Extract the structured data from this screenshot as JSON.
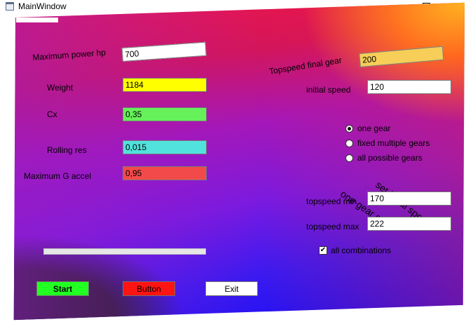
{
  "window": {
    "title": "MainWindow",
    "min_glyph": "—",
    "close_glyph": "✕"
  },
  "inputs": {
    "max_power": {
      "label": "Maximum power hp",
      "value": "700",
      "bg": "#ffffff"
    },
    "weight": {
      "label": "Weight",
      "value": "1184",
      "bg": "#ffff00"
    },
    "cx": {
      "label": "Cx",
      "value": "0,35",
      "bg": "#66f15a"
    },
    "rolling_res": {
      "label": "Rolling res",
      "value": "0,015",
      "bg": "#52e2dd"
    },
    "max_g_accel": {
      "label": "Maximum G accel",
      "value": "0,95",
      "bg": "#f24a4a"
    },
    "topspeed_final_gear": {
      "label": "Topspeed final gear",
      "value": "200",
      "bg": "#f6ce58"
    },
    "initial_speed": {
      "label": "initial speed",
      "value": "120",
      "bg": "#ffffff"
    },
    "topspeed_min": {
      "label": "topspeed min",
      "value": "170",
      "bg": "#ffffff"
    },
    "topspeed_max": {
      "label": "topspeed max",
      "value": "222",
      "bg": "#ffffff"
    }
  },
  "gear_mode": {
    "options": [
      "one gear",
      "fixed multiple gears",
      "all possible gears"
    ],
    "selected": "one gear"
  },
  "rotated_labels": {
    "set_initial_speed": "set initial speed",
    "one_gear_only": "one gear only"
  },
  "all_combinations": {
    "label": "all combinations",
    "checked": true,
    "check_glyph": "✔"
  },
  "progress": {
    "value": 0
  },
  "buttons": {
    "start": {
      "label": "Start",
      "bg": "#22ff22"
    },
    "button": {
      "label": "Button",
      "bg": "#ff1414"
    },
    "exit": {
      "label": "Exit",
      "bg": "#ffffff"
    }
  },
  "colors": {
    "gradient_top": "#f0164a",
    "gradient_mid": "#a517b8",
    "gradient_bottom": "#1a10f5",
    "corner_yellow": "#ffff22",
    "corner_dark": "#202020"
  }
}
